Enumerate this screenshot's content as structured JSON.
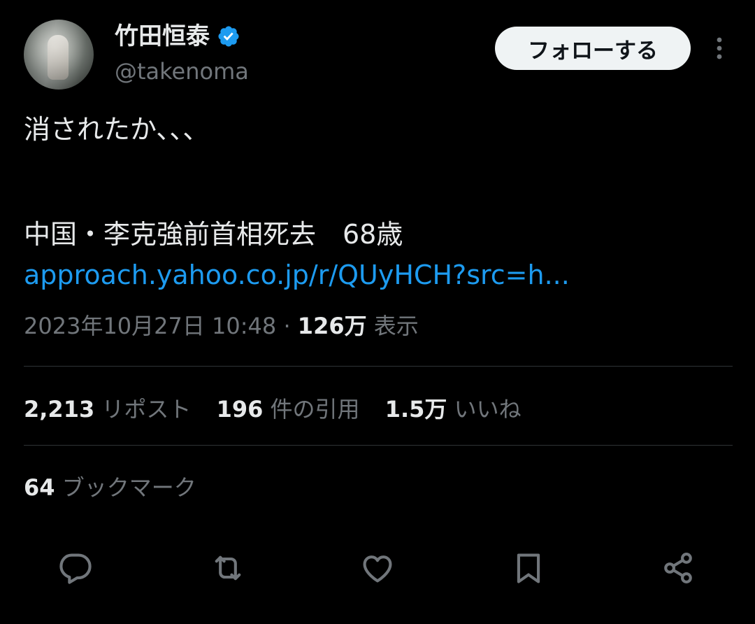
{
  "author": {
    "name": "竹田恒泰",
    "handle": "@takenoma",
    "verified": true
  },
  "follow_label": "フォローする",
  "tweet": {
    "line1": "消されたか、、、",
    "line2": "中国・李克強前首相死去　68歳",
    "link": "approach.yahoo.co.jp/r/QUyHCH?src=h...",
    "timestamp": "2023年10月27日 10:48",
    "separator": "·",
    "views_count": "126万",
    "views_label": "表示"
  },
  "stats": {
    "reposts_count": "2,213",
    "reposts_label": "リポスト",
    "quotes_count": "196",
    "quotes_label": "件の引用",
    "likes_count": "1.5万",
    "likes_label": "いいね",
    "bookmarks_count": "64",
    "bookmarks_label": "ブックマーク"
  },
  "icons": {
    "verified": "verified-badge-icon",
    "more": "more-vertical-icon",
    "reply": "reply-icon",
    "repost": "repost-icon",
    "like": "heart-icon",
    "bookmark": "bookmark-icon",
    "share": "share-icon"
  },
  "colors": {
    "background": "#000000",
    "text": "#e7e9ea",
    "secondary": "#71767b",
    "link": "#1d9bf0",
    "divider": "#2f3336",
    "follow_bg": "#eff3f4"
  }
}
